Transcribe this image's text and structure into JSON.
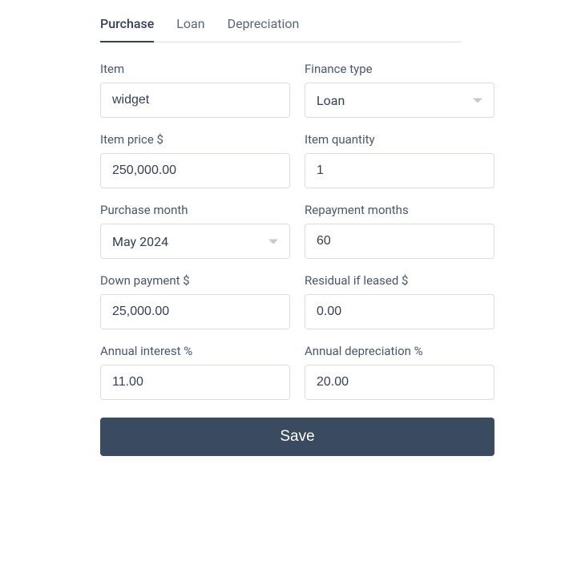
{
  "tabs": {
    "purchase": "Purchase",
    "loan": "Loan",
    "depreciation": "Depreciation"
  },
  "fields": {
    "item": {
      "label": "Item",
      "value": "widget"
    },
    "finance_type": {
      "label": "Finance type",
      "value": "Loan"
    },
    "item_price": {
      "label": "Item price $",
      "value": "250,000.00"
    },
    "item_quantity": {
      "label": "Item quantity",
      "value": "1"
    },
    "purchase_month": {
      "label": "Purchase month",
      "value": "May 2024"
    },
    "repayment_months": {
      "label": "Repayment months",
      "value": "60"
    },
    "down_payment": {
      "label": "Down payment $",
      "value": "25,000.00"
    },
    "residual": {
      "label": "Residual if leased $",
      "value": "0.00"
    },
    "annual_interest": {
      "label": "Annual interest %",
      "value": "11.00"
    },
    "annual_depreciation": {
      "label": "Annual depreciation %",
      "value": "20.00"
    }
  },
  "actions": {
    "save": "Save"
  }
}
